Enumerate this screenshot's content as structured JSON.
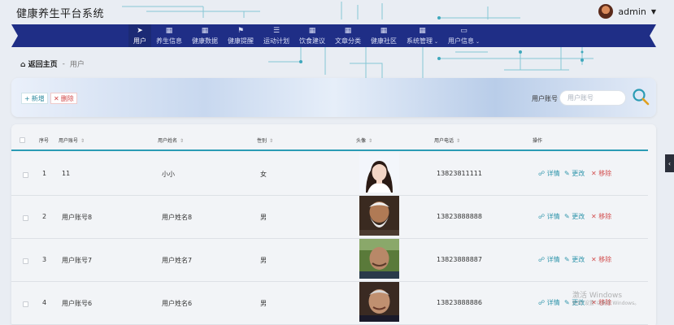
{
  "app": {
    "title": "健康养生平台系统"
  },
  "user": {
    "name": "admin"
  },
  "nav": {
    "items": [
      {
        "label": "用户",
        "icon": "paper-plane-icon",
        "glyph": "➤",
        "active": true
      },
      {
        "label": "养生信息",
        "icon": "grid-icon",
        "glyph": "▦"
      },
      {
        "label": "健康数据",
        "icon": "grid-icon",
        "glyph": "▦"
      },
      {
        "label": "健康提醒",
        "icon": "flag-icon",
        "glyph": "⚑"
      },
      {
        "label": "运动计划",
        "icon": "list-icon",
        "glyph": "☰"
      },
      {
        "label": "饮食建议",
        "icon": "grid-icon",
        "glyph": "▦"
      },
      {
        "label": "文章分类",
        "icon": "grid-icon",
        "glyph": "▦"
      },
      {
        "label": "健康社区",
        "icon": "grid-icon",
        "glyph": "▦"
      },
      {
        "label": "系统管理",
        "icon": "grid-icon",
        "glyph": "▦",
        "dropdown": true
      },
      {
        "label": "用户信息",
        "icon": "window-icon",
        "glyph": "▭",
        "dropdown": true
      }
    ]
  },
  "breadcrumb": {
    "home": "返回主页",
    "separator": "-",
    "current": "用户"
  },
  "toolbar": {
    "add_label": "新增",
    "delete_label": "删除",
    "search_label": "用户账号",
    "search_placeholder": "用户账号"
  },
  "table": {
    "columns": [
      "序号",
      "用户账号",
      "用户姓名",
      "性别",
      "头像",
      "用户电话",
      "操作"
    ],
    "rows": [
      {
        "index": "1",
        "account": "11",
        "name": "小小",
        "gender": "女",
        "phone": "13823811111"
      },
      {
        "index": "2",
        "account": "用户账号8",
        "name": "用户姓名8",
        "gender": "男",
        "phone": "13823888888"
      },
      {
        "index": "3",
        "account": "用户账号7",
        "name": "用户姓名7",
        "gender": "男",
        "phone": "13823888887"
      },
      {
        "index": "4",
        "account": "用户账号6",
        "name": "用户姓名6",
        "gender": "男",
        "phone": "13823888886"
      }
    ],
    "actions": {
      "detail": "详情",
      "edit": "更改",
      "remove": "移除"
    }
  },
  "watermark": {
    "line1": "激活 Windows",
    "line2": "转到\"设置\"以激活 Windows。"
  },
  "colors": {
    "nav": "#1f2e86",
    "accent": "#2b9bb4",
    "danger": "#d04545"
  }
}
